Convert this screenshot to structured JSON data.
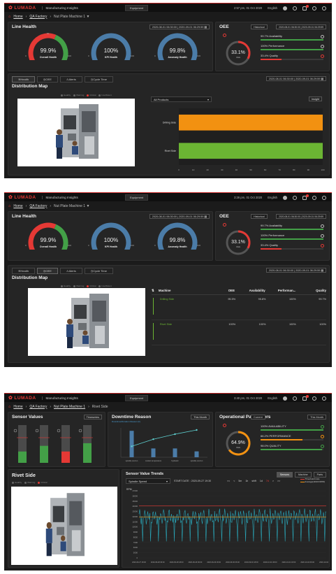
{
  "app": {
    "brand": "LUMADA",
    "name": "Manufacturing Insights",
    "tab": "Equipment"
  },
  "screens": [
    {
      "time": "2:57 pm, 01 Oct 2020",
      "language": "English",
      "breadcrumb": [
        "Home",
        "QA Factory",
        "Nut Plate Machine 1 ▼"
      ],
      "line_health": {
        "title": "Line Health",
        "date_range": "2020-08-01 06:30:00 | 2020-09-01 06:29:59",
        "gauges": [
          {
            "label": "Overall Health",
            "value": "99.9%",
            "level": 0.999,
            "color": "#43a047",
            "scale_min": "0",
            "scale_max": "100",
            "scale_mid": "50"
          },
          {
            "label": "KPI Health",
            "value": "100%",
            "level": 1.0,
            "color": "#4b7ca8",
            "scale_min": "0",
            "scale_max": "100",
            "scale_mid": ""
          },
          {
            "label": "Anomaly Health",
            "value": "99.8%",
            "level": 0.998,
            "color": "#4b7ca8",
            "scale_min": "0",
            "scale_max": "100",
            "scale_mid": ""
          }
        ]
      },
      "oee": {
        "title": "OEE",
        "mode": "Historical",
        "date_range": "2020-08-01 06:30:00 | 2020-09-01 06:29:59",
        "value": "33.1%",
        "sub": "OEE",
        "rows": [
          {
            "label": "99.7% Availability",
            "level": 0.997,
            "color": "#43a047"
          },
          {
            "label": "100% Performance",
            "level": 1.0,
            "color": "#43a047"
          },
          {
            "label": "33.4% Quality",
            "level": 0.334,
            "color": "#e53935"
          }
        ]
      },
      "bottom": {
        "tabs": [
          "Health",
          "OEE",
          "Alerts",
          "Cycle Time"
        ],
        "active_tab": "Health",
        "date_range": "2020-08-01 06:30:00 | 2020-09-01 06:29:59",
        "title": "Distribution Map",
        "legend": [
          "Healthy",
          "Warning",
          "Critical",
          "Insufficient"
        ],
        "filter": "All Products",
        "insight": "Insight",
        "chart_data": {
          "type": "bar",
          "categories": [
            "Drilling Side",
            "Rivet Side"
          ],
          "values": [
            100,
            100
          ],
          "colors": [
            "#f29111",
            "#6bb533"
          ],
          "xlim": [
            0,
            100
          ],
          "xticks": [
            "0",
            "10",
            "20",
            "30",
            "40",
            "50",
            "60",
            "70",
            "80",
            "90",
            "100"
          ]
        }
      }
    },
    {
      "time": "3:26 pm, 01 Oct 2020",
      "language": "English",
      "breadcrumb": [
        "Home",
        "QA Factory",
        "Nut Plate Machine 1 ▼"
      ],
      "line_health": {
        "title": "Line Health",
        "date_range": "2020-08-01 06:30:00 | 2020-09-01 06:29:59",
        "gauges": [
          {
            "label": "Overall Health",
            "value": "99.9%",
            "level": 0.999,
            "color": "#43a047",
            "scale_min": "0",
            "scale_max": "100",
            "scale_mid": ""
          },
          {
            "label": "KPI Health",
            "value": "100%",
            "level": 1.0,
            "color": "#4b7ca8",
            "scale_min": "0",
            "scale_max": "100",
            "scale_mid": ""
          },
          {
            "label": "Anomaly Health",
            "value": "99.8%",
            "level": 0.998,
            "color": "#4b7ca8",
            "scale_min": "0",
            "scale_max": "100",
            "scale_mid": ""
          }
        ]
      },
      "oee": {
        "title": "OEE",
        "mode": "Historical",
        "date_range": "2020-08-01 06:30:00 | 2020-09-01 06:29:59",
        "value": "33.1%",
        "sub": "OEE",
        "rows": [
          {
            "label": "99.7% Availability",
            "level": 0.997,
            "color": "#43a047"
          },
          {
            "label": "100% Performance",
            "level": 1.0,
            "color": "#43a047"
          },
          {
            "label": "33.4% Quality",
            "level": 0.334,
            "color": "#e53935"
          }
        ]
      },
      "bottom": {
        "tabs": [
          "Health",
          "OEE",
          "Alerts",
          "Cycle Time"
        ],
        "active_tab": "OEE",
        "date_range": "2020-08-01 06:30:00 | 2020-09-01 06:29:59",
        "title": "Distribution Map",
        "legend": [
          "Healthy",
          "Warning",
          "Critical",
          "Insufficient"
        ],
        "table": {
          "columns": [
            "Machine",
            "OEE",
            "Availability",
            "Performan...",
            "Quality"
          ],
          "rows": [
            [
              "Drilling Side",
              "95.5%",
              "95.8%",
              "100%",
              "99.7%"
            ],
            [
              "Rivet Side",
              "100%",
              "100%",
              "100%",
              "100%"
            ]
          ]
        }
      }
    },
    {
      "time": "3:40 pm, 01 Oct 2020",
      "language": "English",
      "breadcrumb": [
        "Home",
        "QA Factory",
        "Nut Plate Machine 1",
        "Rivet Side"
      ],
      "sensor_values": {
        "title": "Sensor Values",
        "filter": "Timeseries"
      },
      "downtime": {
        "title": "Downtime Reason",
        "subtitle": "Downtime/Duration Reason (h)",
        "period": "This Month",
        "chart_data": {
          "type": "bar",
          "categories": [
            "spindle overrun",
            "coolant temperature",
            "hydraulic",
            "spindle overrun"
          ],
          "values": [
            9,
            3,
            3,
            2
          ],
          "line": [
            2.6,
            4.3,
            5.5,
            6.5
          ]
        }
      },
      "op_params": {
        "title": "Operational Parameters",
        "mode": "Current",
        "period": "This Month",
        "value": "64.9%",
        "sub": "OEE",
        "rows": [
          {
            "label": "100% AVAILABILITY",
            "level": 1.0,
            "color": "#43a047"
          },
          {
            "label": "66.2% PERFORMANCE",
            "level": 0.662,
            "color": "#f29111"
          },
          {
            "label": "98.0% QUALITY",
            "level": 0.98,
            "color": "#43a047"
          }
        ]
      },
      "rivet": {
        "title": "Rivet Side",
        "legend": [
          "Healthy",
          "Warning",
          "Critical"
        ]
      },
      "trends": {
        "title": "Sensor Value Trends",
        "sensor": "Spindle Speed",
        "start": "START DATE : 2020-09-27 19:30",
        "views": [
          "Sensors",
          "Machine",
          "Parts"
        ],
        "ranges": [
          "<<",
          "<",
          "5m",
          "1h",
          "shift",
          "1d",
          "7d",
          ">",
          ">>"
        ],
        "active_range": "7d",
        "legend": [
          "Threshold limits",
          "Average(11933 RPM)"
        ],
        "ylabel": "RPM",
        "yticks": [
          "17000",
          "16000",
          "15000",
          "14000",
          "13000",
          "12000",
          "11000",
          "10000",
          "9000",
          "8000",
          "7000",
          "6000",
          "5000",
          "0"
        ],
        "xticks": [
          "2020-09-27 18:00",
          "2020-09-28 06:00",
          "2020-09-28 18:00",
          "2020-09-29 06:00",
          "2020-09-29 18:00",
          "2020-09-30 06:00",
          "2020-09-30 18:00",
          "2020-10-01 06:00",
          "2020-10-01 18:00",
          "2020-10-02 06:00",
          "2020-10-02 18:00"
        ]
      }
    }
  ]
}
